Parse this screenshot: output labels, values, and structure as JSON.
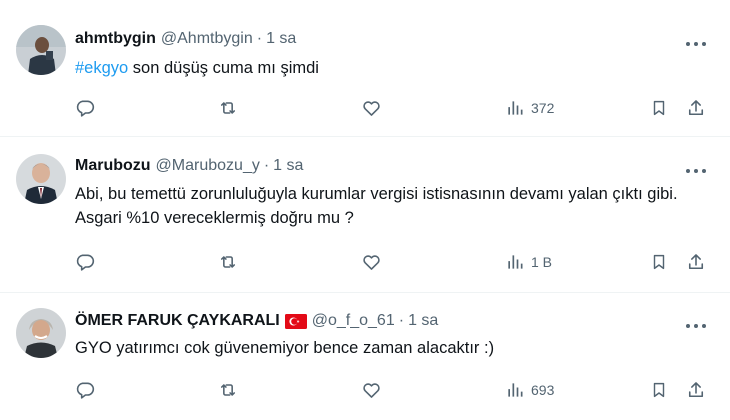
{
  "tweets": [
    {
      "name": "ahmtbygin",
      "handle": "@Ahmtbygin",
      "separator": "·",
      "time": "1 sa",
      "hashtag": "#ekgyo",
      "text": " son düşüş cuma mı şimdi",
      "views": "372"
    },
    {
      "name": "Marubozu",
      "handle": "@Marubozu_y",
      "separator": "·",
      "time": "1 sa",
      "text": "Abi, bu temettü zorunluluğuyla kurumlar vergisi istisnasının devamı yalan çıktı gibi. Asgari %10 vereceklermiş doğru mu ?",
      "views": "1 B"
    },
    {
      "name": "ÖMER FARUK ÇAYKARALI",
      "flag": "turkey-flag",
      "handle": "@o_f_o_61",
      "separator": "·",
      "time": "1 sa",
      "text": "GYO yatırımcı cok güvenemiyor bence zaman alacaktır :)",
      "views": "693"
    }
  ],
  "icons": [
    "more-icon",
    "reply-icon",
    "retweet-icon",
    "like-icon",
    "views-icon",
    "bookmark-icon",
    "share-icon"
  ],
  "colors": {
    "accent": "#1d9bf0",
    "muted": "#536471",
    "text": "#0f1419",
    "flag_red": "#e30a17"
  }
}
